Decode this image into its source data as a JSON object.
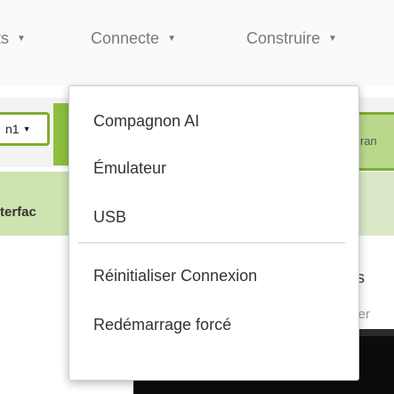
{
  "menubar": {
    "items": [
      {
        "label": "ts",
        "has_caret": true
      },
      {
        "label": "Connecte",
        "has_caret": true
      },
      {
        "label": "Construire",
        "has_caret": true
      }
    ]
  },
  "toolbar": {
    "screen_select": "n1",
    "right_button": "ran"
  },
  "panels": {
    "left_header": "terfac",
    "right_title": "nts",
    "right_subtitle": "aper"
  },
  "dropdown": {
    "items": [
      {
        "label": "Compagnon AI"
      },
      {
        "label": "Émulateur"
      },
      {
        "label": "USB"
      },
      {
        "label": "Réinitialiser Connexion"
      },
      {
        "label": "Redémarrage forcé"
      }
    ]
  },
  "colors": {
    "accent_green": "#7dae2e",
    "menu_text": "#7a7a7a",
    "dropdown_text": "#333333"
  }
}
